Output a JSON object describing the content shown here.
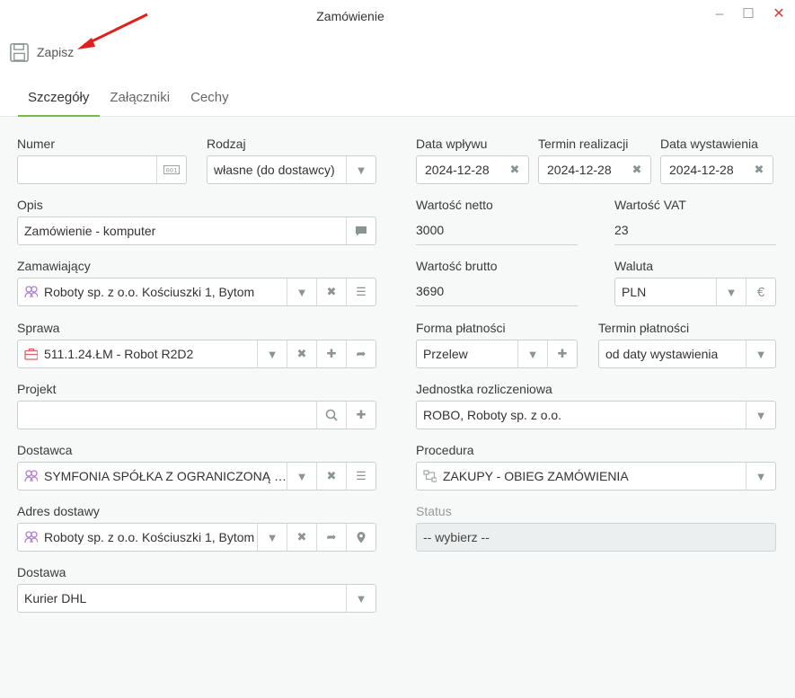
{
  "window": {
    "title": "Zamówienie"
  },
  "toolbar": {
    "save_label": "Zapisz"
  },
  "tabs": [
    "Szczegóły",
    "Załączniki",
    "Cechy"
  ],
  "fields": {
    "numer": {
      "label": "Numer",
      "value": ""
    },
    "rodzaj": {
      "label": "Rodzaj",
      "value": "własne (do dostawcy)"
    },
    "opis": {
      "label": "Opis",
      "value": "Zamówienie - komputer"
    },
    "zamawiajacy": {
      "label": "Zamawiający",
      "value": "Roboty sp. z o.o. Kościuszki 1, Bytom"
    },
    "sprawa": {
      "label": "Sprawa",
      "value": "511.1.24.ŁM - Robot R2D2"
    },
    "projekt": {
      "label": "Projekt",
      "value": ""
    },
    "dostawca": {
      "label": "Dostawca",
      "value": "SYMFONIA SPÓŁKA Z OGRANICZONĄ ODPOWIEDZIALNOŚCIĄ"
    },
    "adres": {
      "label": "Adres dostawy",
      "value": "Roboty sp. z o.o. Kościuszki 1, Bytom"
    },
    "dostawa": {
      "label": "Dostawa",
      "value": "Kurier DHL"
    },
    "data_wplywu": {
      "label": "Data wpływu",
      "value": "2024-12-28"
    },
    "termin_realizacji": {
      "label": "Termin realizacji",
      "value": "2024-12-28"
    },
    "data_wystawienia": {
      "label": "Data wystawienia",
      "value": "2024-12-28"
    },
    "wartosc_netto": {
      "label": "Wartość netto",
      "value": "3000"
    },
    "wartosc_vat": {
      "label": "Wartość VAT",
      "value": "23"
    },
    "wartosc_brutto": {
      "label": "Wartość brutto",
      "value": "3690"
    },
    "waluta": {
      "label": "Waluta",
      "value": "PLN"
    },
    "forma_platnosci": {
      "label": "Forma płatności",
      "value": "Przelew"
    },
    "termin_platnosci": {
      "label": "Termin płatności",
      "value": "od daty wystawienia"
    },
    "jednostka": {
      "label": "Jednostka rozliczeniowa",
      "value": "ROBO, Roboty sp. z o.o."
    },
    "procedura": {
      "label": "Procedura",
      "value": "ZAKUPY - OBIEG ZAMÓWIENIA"
    },
    "status": {
      "label": "Status",
      "value": "-- wybierz --"
    }
  },
  "icons": {
    "currency": "€"
  },
  "colors": {
    "accent_green": "#7bb74c",
    "close_red": "#e03a3a",
    "arrow_red": "#e02020",
    "org_icon": "#b07fd0",
    "case_icon": "#e06060"
  }
}
